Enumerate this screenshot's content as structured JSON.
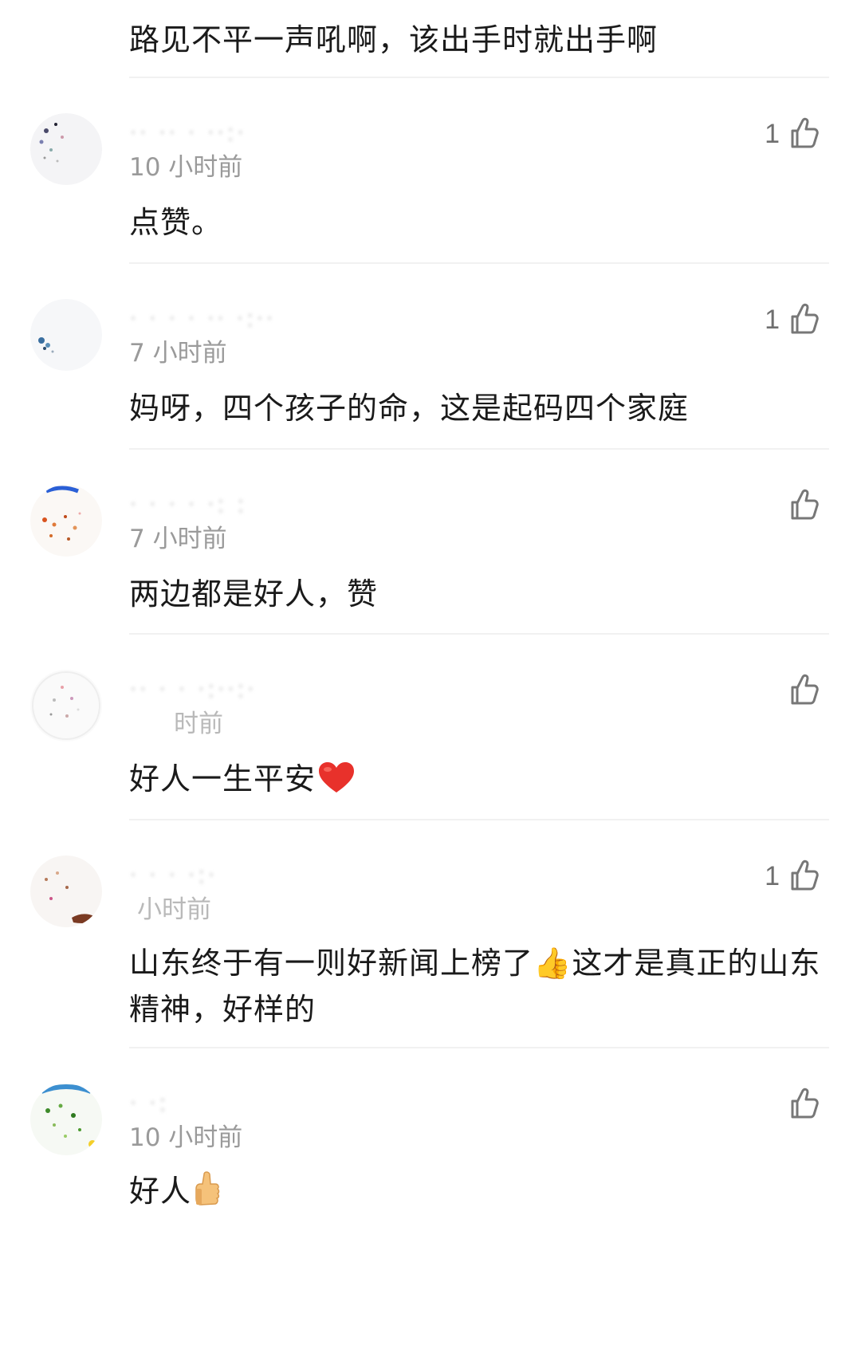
{
  "top_comment_tail": "路见不平一声吼啊，该出手时就出手啊",
  "comments": [
    {
      "username": "·· ·· · ··:·",
      "time": "10 小时前",
      "text": "点赞。",
      "likes": "1"
    },
    {
      "username": "· · · · ·· ·:··",
      "time": "7 小时前",
      "text": "妈呀，四个孩子的命，这是起码四个家庭",
      "likes": "1"
    },
    {
      "username": "· ·  ·  · ·: :",
      "time": "7 小时前",
      "text": "两边都是好人，赞",
      "likes": ""
    },
    {
      "username": "·· · · ·:··:·",
      "time": "时前",
      "text": "好人一生平安",
      "likes": ""
    },
    {
      "username": "· · · ·:·",
      "time": "小时前",
      "text": "山东终于有一则好新闻上榜了👍这才是真正的山东精神，好样的",
      "likes": "1"
    },
    {
      "username": "· ·:",
      "time": "10 小时前",
      "text": "好人",
      "likes": ""
    }
  ],
  "icons": {
    "like": "thumbs-up-outline-icon",
    "heart": "red-heart-icon",
    "thumbs": "thumbs-up-emoji-icon"
  },
  "colors": {
    "text": "#1a1a1a",
    "time": "#9a9a9a",
    "divider": "#f1f1f1",
    "like_icon": "#777777",
    "heart": "#e8312b",
    "emoji_skin": "#f5c27a"
  }
}
